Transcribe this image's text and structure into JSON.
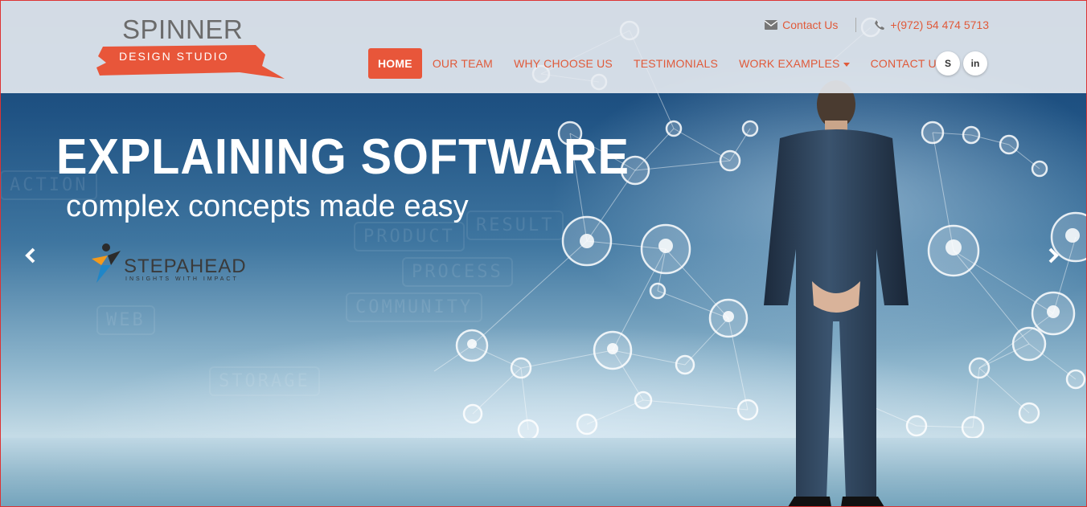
{
  "brand": {
    "title": "SPINNER",
    "subtitle": "DESIGN STUDIO",
    "accent_color": "#e8563a"
  },
  "topbar": {
    "contact_label": "Contact Us",
    "contact_icon": "envelope-icon",
    "phone": "+(972) 54 474 5713",
    "phone_icon": "phone-icon"
  },
  "nav": {
    "items": [
      {
        "label": "HOME",
        "active": true
      },
      {
        "label": "OUR TEAM"
      },
      {
        "label": "WHY CHOOSE US"
      },
      {
        "label": "TESTIMONIALS"
      },
      {
        "label": "WORK EXAMPLES"
      },
      {
        "label": "CONTACT US"
      }
    ]
  },
  "social": {
    "skype": "S",
    "linkedin": "in"
  },
  "hero": {
    "headline": "EXPLAINING SOFTWARE",
    "subline": "complex concepts made easy",
    "partner_name": "STEPAHEAD",
    "partner_tagline": "INSIGHTS WITH IMPACT"
  },
  "background_sketch": [
    "ACTION",
    "PRODUCT",
    "RESULT",
    "PROCESS",
    "COMMUNITY",
    "STORAGE",
    "WEB"
  ]
}
